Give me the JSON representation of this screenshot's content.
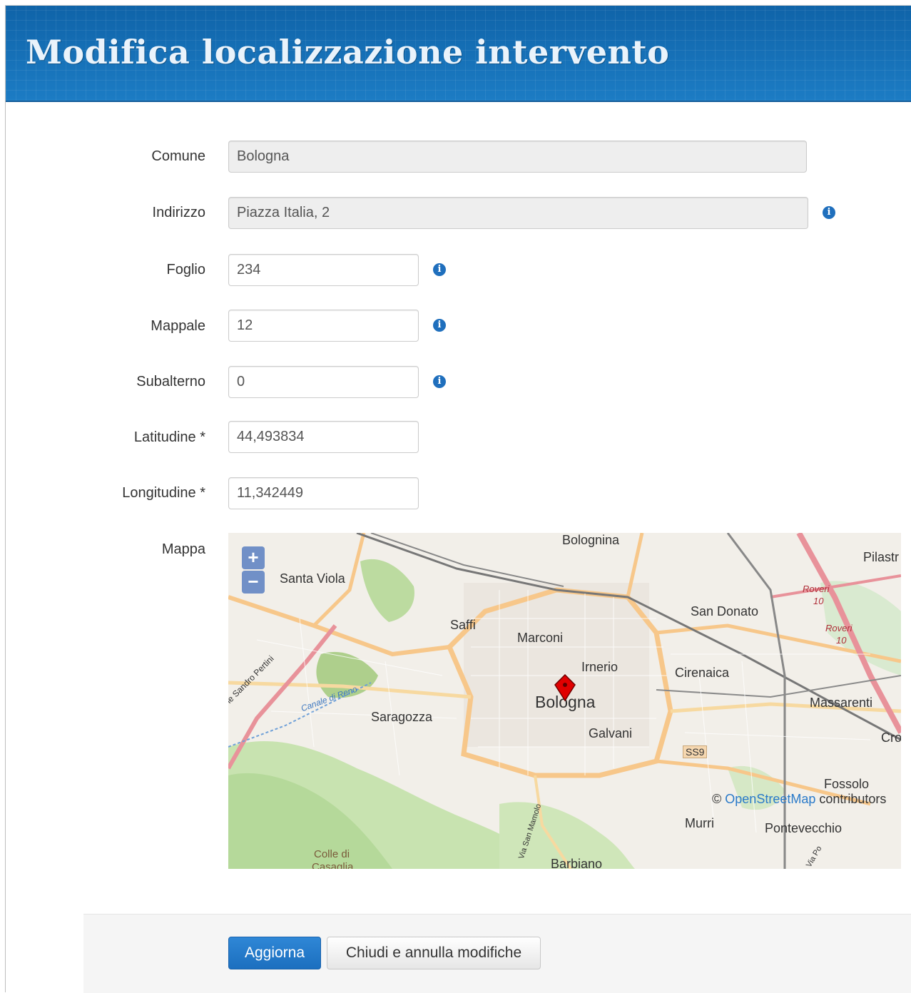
{
  "header": {
    "title": "Modifica localizzazione intervento"
  },
  "form": {
    "comune": {
      "label": "Comune",
      "value": "Bologna"
    },
    "indirizzo": {
      "label": "Indirizzo",
      "value": "Piazza Italia, 2"
    },
    "foglio": {
      "label": "Foglio",
      "value": "234"
    },
    "mappale": {
      "label": "Mappale",
      "value": "12"
    },
    "subalterno": {
      "label": "Subalterno",
      "value": "0"
    },
    "latitudine": {
      "label": "Latitudine *",
      "value": "44,493834"
    },
    "longitudine": {
      "label": "Longitudine *",
      "value": "11,342449"
    },
    "mappa": {
      "label": "Mappa"
    }
  },
  "map": {
    "zoom_in": "+",
    "zoom_out": "−",
    "attribution_prefix": "©",
    "attribution_link": "OpenStreetMap",
    "attribution_suffix": "contributors",
    "place_labels": {
      "bolognina": "Bolognina",
      "pilastro": "Pilastr",
      "santa_viola": "Santa Viola",
      "roveri1": "Roveri",
      "roveri1_num": "10",
      "roveri2": "Roveri",
      "roveri2_num": "10",
      "san_donato": "San Donato",
      "saffi": "Saffi",
      "marconi": "Marconi",
      "irnerio": "Irnerio",
      "cirenaica": "Cirenaica",
      "bologna": "Bologna",
      "massarenti": "Massarenti",
      "galvani": "Galvani",
      "saragozza": "Saragozza",
      "cro": "Cro",
      "ss9": "SS9",
      "fossolo": "Fossolo",
      "murri": "Murri",
      "pontevecchio": "Pontevecchio",
      "colle_di": "Colle di",
      "casaglia": "Casaglia",
      "barbiano": "Barbiano",
      "sandro_pertini": "le Sandro Pertini",
      "canale_di_reno": "Canale di Reno",
      "via_san_mamolo": "Via San Mamolo",
      "via_po": "Via Po"
    },
    "colors": {
      "roads_major": "#f7c78a",
      "motorway": "#e8929a",
      "park": "#c8e3b0",
      "rail": "#777777"
    }
  },
  "footer": {
    "update": "Aggiorna",
    "cancel": "Chiudi e annulla modifiche"
  },
  "icons": {
    "info": "info-icon",
    "marker": "map-marker-icon"
  }
}
